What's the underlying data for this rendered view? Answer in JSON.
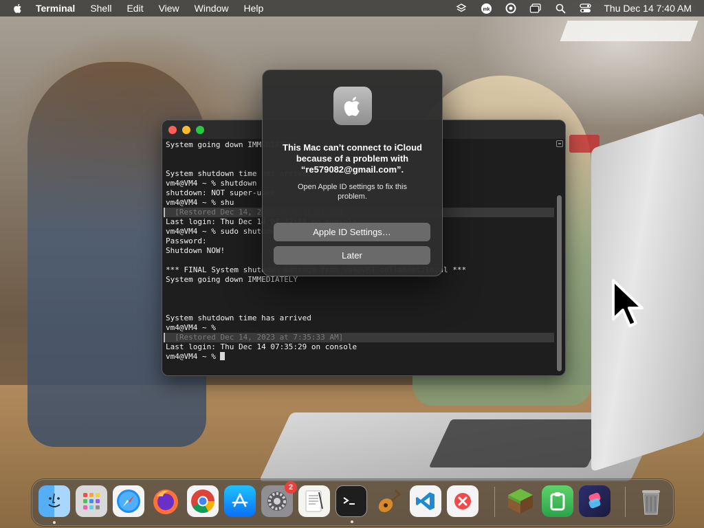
{
  "menubar": {
    "app_name": "Terminal",
    "items": [
      "Shell",
      "Edit",
      "View",
      "Window",
      "Help"
    ],
    "clock": "Thu Dec 14  7:40 AM",
    "status_icons": [
      "layers-icon",
      "mk-avatar-icon",
      "screen-record-icon",
      "window-icon",
      "search-icon",
      "control-center-icon"
    ]
  },
  "terminal": {
    "lines": [
      "System going down IMMEDIATELY",
      "",
      "",
      "System shutdown time has arrived",
      "vm4@VM4 ~ % shutdown",
      "shutdown: NOT super-user",
      "vm4@VM4 ~ % shu",
      "  [Restored Dec 14, 2023 at 7:33:01 AM]",
      "Last login: Thu Dec 14 07:32:58 on console",
      "vm4@VM4 ~ % sudo shutdown -h now",
      "Password:",
      "Shutdown NOW!",
      "",
      "*** FINAL System shutdown message from vm4@VM4.collabnet.local ***",
      "System going down IMMEDIATELY",
      "",
      "",
      "",
      "System shutdown time has arrived",
      "vm4@VM4 ~ %",
      "  [Restored Dec 14, 2023 at 7:35:33 AM]",
      "Last login: Thu Dec 14 07:35:29 on console",
      "vm4@VM4 ~ % "
    ]
  },
  "dialog": {
    "title": "This Mac can’t connect to iCloud because of a problem with “re579082@gmail.com”.",
    "message": "Open Apple ID settings to fix this problem.",
    "primary_button": "Apple ID Settings…",
    "secondary_button": "Later"
  },
  "dock": {
    "items": [
      {
        "name": "finder",
        "icon": "finder-icon",
        "running": true
      },
      {
        "name": "launchpad",
        "icon": "launchpad-icon",
        "running": false
      },
      {
        "name": "safari",
        "icon": "safari-icon",
        "running": false
      },
      {
        "name": "firefox",
        "icon": "firefox-icon",
        "running": false
      },
      {
        "name": "chrome",
        "icon": "chrome-icon",
        "running": false
      },
      {
        "name": "app-store",
        "icon": "app-store-icon",
        "running": false
      },
      {
        "name": "system-settings",
        "icon": "gear-icon",
        "running": false,
        "badge": "2"
      },
      {
        "name": "textedit",
        "icon": "textedit-icon",
        "running": false
      },
      {
        "name": "terminal",
        "icon": "terminal-icon",
        "running": true
      },
      {
        "name": "garageband",
        "icon": "guitar-icon",
        "running": false
      },
      {
        "name": "vscode",
        "icon": "vscode-icon",
        "running": false
      },
      {
        "name": "cleaner",
        "icon": "close-x-icon",
        "running": false
      },
      {
        "name": "minecraft",
        "icon": "grass-block-icon",
        "running": false
      },
      {
        "name": "clipboard",
        "icon": "clipboard-icon",
        "running": false
      },
      {
        "name": "shortcuts",
        "icon": "shortcuts-icon",
        "running": false
      },
      {
        "name": "trash",
        "icon": "trash-icon",
        "running": false
      }
    ]
  }
}
